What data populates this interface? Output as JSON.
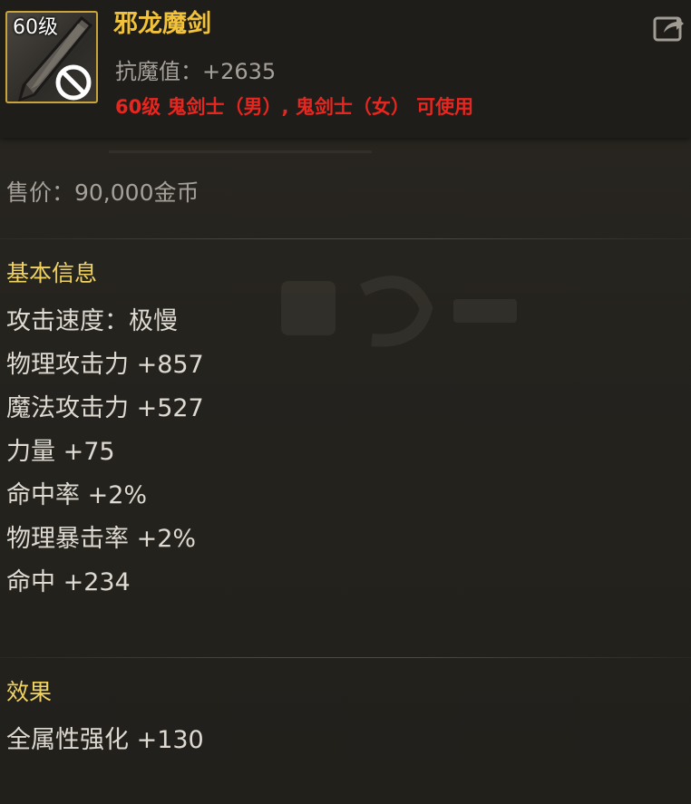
{
  "header": {
    "item_level": "60级",
    "item_name": "邪龙魔剑",
    "anti_magic": "抗魔值：+2635",
    "class_requirement": "60级 鬼剑士（男）, 鬼剑士（女） 可使用",
    "icon": "sword-icon",
    "share_icon": "share-icon"
  },
  "price": "售价：90,000金币",
  "basic_info": {
    "title": "基本信息",
    "stats": [
      "攻击速度：极慢",
      "物理攻击力 +857",
      "魔法攻击力 +527",
      "力量 +75",
      "命中率 +2%",
      "物理暴击率 +2%",
      "命中 +234"
    ]
  },
  "effects": {
    "title": "效果",
    "stats": [
      "全属性强化 +130"
    ]
  },
  "colors": {
    "item_name": "#f2c33a",
    "class_requirement": "#e8261f",
    "section_title": "#f0d262",
    "icon_border": "#c9a43c"
  }
}
